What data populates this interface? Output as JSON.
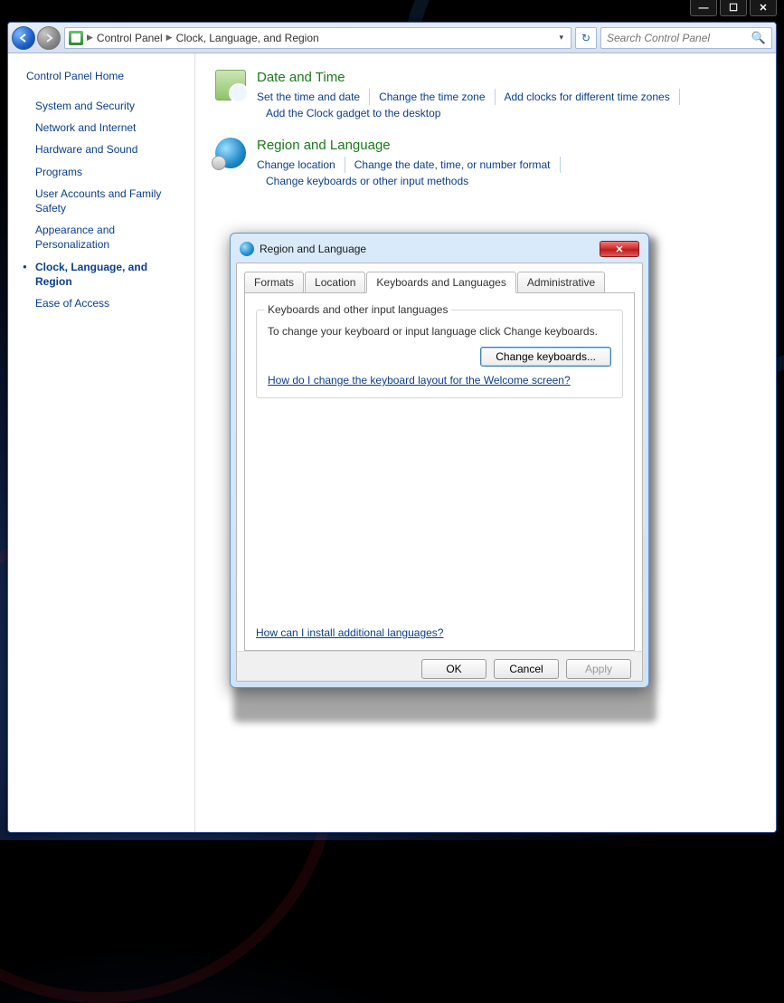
{
  "window": {
    "minimize": "—",
    "maximize": "☐",
    "close": "✕"
  },
  "breadcrumb": {
    "root": "Control Panel",
    "current": "Clock, Language, and Region"
  },
  "search": {
    "placeholder": "Search Control Panel"
  },
  "sidebar": {
    "home": "Control Panel Home",
    "items": [
      {
        "label": "System and Security"
      },
      {
        "label": "Network and Internet"
      },
      {
        "label": "Hardware and Sound"
      },
      {
        "label": "Programs"
      },
      {
        "label": "User Accounts and Family Safety"
      },
      {
        "label": "Appearance and Personalization"
      },
      {
        "label": "Clock, Language, and Region"
      },
      {
        "label": "Ease of Access"
      }
    ]
  },
  "categories": {
    "date_time": {
      "title": "Date and Time",
      "tasks": [
        "Set the time and date",
        "Change the time zone",
        "Add clocks for different time zones",
        "Add the Clock gadget to the desktop"
      ]
    },
    "region_lang": {
      "title": "Region and Language",
      "tasks": [
        "Change location",
        "Change the date, time, or number format",
        "Change keyboards or other input methods"
      ]
    }
  },
  "dialog": {
    "title": "Region and Language",
    "tabs": {
      "formats": "Formats",
      "location": "Location",
      "keyboards": "Keyboards and Languages",
      "admin": "Administrative"
    },
    "group_legend": "Keyboards and other input languages",
    "group_text": "To change your keyboard or input language click Change keyboards.",
    "change_btn": "Change keyboards...",
    "help_link": "How do I change the keyboard layout for the Welcome screen?",
    "bottom_link": "How can I install additional languages?",
    "ok": "OK",
    "cancel": "Cancel",
    "apply": "Apply"
  }
}
